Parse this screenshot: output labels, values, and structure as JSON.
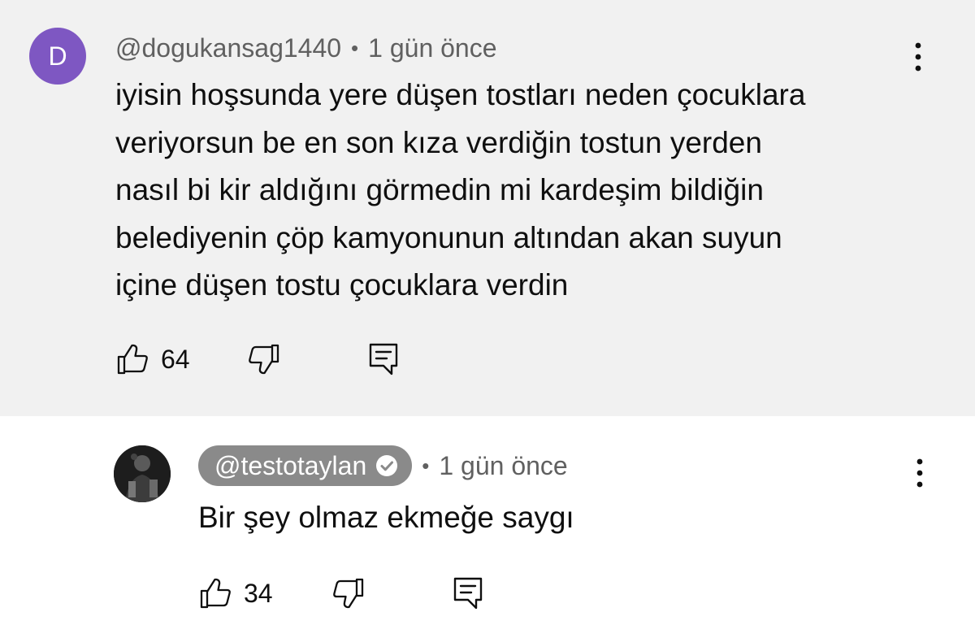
{
  "comments": [
    {
      "avatar_letter": "D",
      "avatar_color": "#7e57c2",
      "handle": "@dogukansag1440",
      "separator": "•",
      "time": "1 gün önce",
      "text_lines": [
        "iyisin hoşsunda yere düşen tostları neden çocuklara",
        "veriyorsun be en son kıza verdiğin tostun yerden",
        "nasıl bi kir aldığını görmedin mi kardeşim bildiğin",
        "belediyenin çöp kamyonunun altından akan suyun",
        "içine düşen tostu çocuklara verdin"
      ],
      "like_count": "64"
    },
    {
      "handle": "@testotaylan",
      "verified": true,
      "separator": "•",
      "time": "1 gün önce",
      "text_lines": [
        "Bir şey olmaz ekmeğe saygı"
      ],
      "like_count": "34"
    }
  ],
  "colors": {
    "top_background": "#f1f1f1",
    "reply_background": "#ffffff",
    "meta_text": "#606060",
    "handle_pill": "#8a8a8a"
  },
  "icons": [
    "thumb-up-icon",
    "thumb-down-icon",
    "reply-icon",
    "more-vert-icon",
    "verified-check-icon"
  ]
}
